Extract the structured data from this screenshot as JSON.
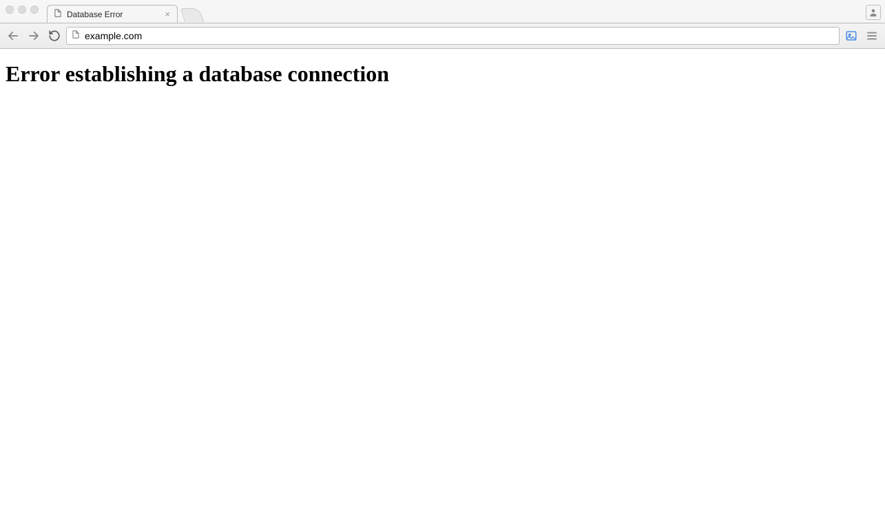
{
  "browser": {
    "tabs": [
      {
        "title": "Database Error"
      }
    ],
    "address": "example.com"
  },
  "page": {
    "heading": "Error establishing a database connection"
  }
}
